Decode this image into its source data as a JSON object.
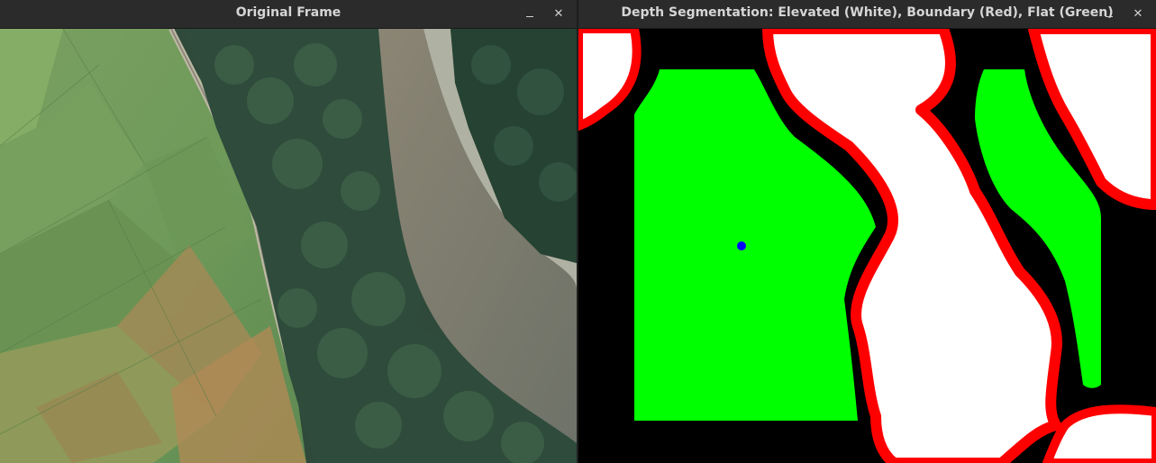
{
  "windows": {
    "left": {
      "title": "Original Frame",
      "minimize_glyph": "–",
      "close_glyph": "✕"
    },
    "right": {
      "title": "Depth Segmentation: Elevated (White), Boundary (Red), Flat (Green)",
      "minimize_glyph": "–",
      "close_glyph": "✕"
    }
  },
  "segmentation": {
    "colors": {
      "elevated": "#ffffff",
      "boundary": "#ff0000",
      "flat": "#00ff00",
      "background": "#000000",
      "marker": "#0000ff"
    }
  },
  "icons": [
    "minimize-icon",
    "close-icon"
  ]
}
